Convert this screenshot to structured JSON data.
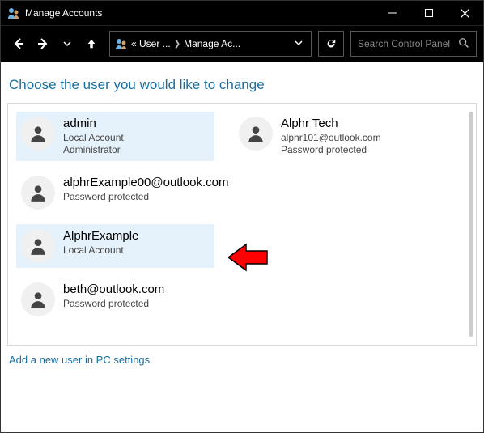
{
  "window": {
    "title": "Manage Accounts"
  },
  "nav": {
    "crumb1": "« User ...",
    "crumb2": "Manage Ac...",
    "search_placeholder": "Search Control Panel"
  },
  "heading": "Choose the user you would like to change",
  "accounts": [
    {
      "name": "admin",
      "line1": "Local Account",
      "line2": "Administrator"
    },
    {
      "name": "Alphr Tech",
      "line1": "alphr101@outlook.com",
      "line2": "Password protected"
    },
    {
      "name": "alphrExample00@outlook.com",
      "line1": "Password protected",
      "line2": ""
    },
    {
      "name": "AlphrExample",
      "line1": "Local Account",
      "line2": ""
    },
    {
      "name": "beth@outlook.com",
      "line1": "Password protected",
      "line2": ""
    }
  ],
  "add_link": "Add a new user in PC settings"
}
